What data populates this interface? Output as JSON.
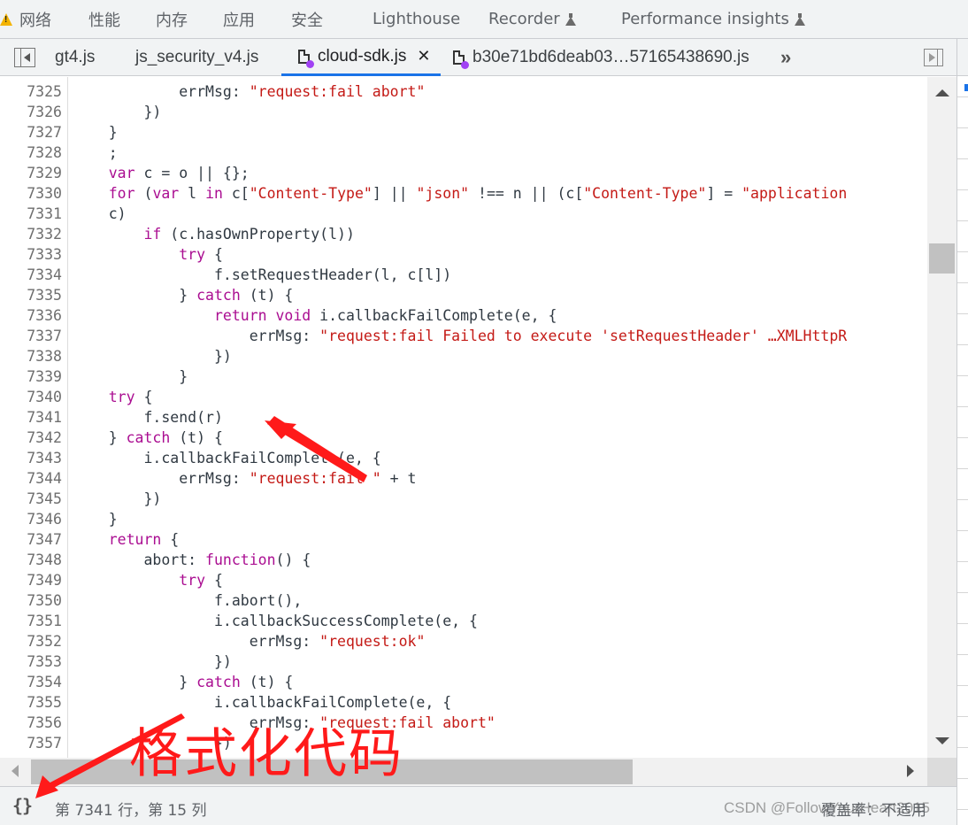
{
  "panel_tabs": [
    {
      "label": "网络",
      "warning": true
    },
    {
      "label": "性能"
    },
    {
      "label": "内存"
    },
    {
      "label": "应用"
    },
    {
      "label": "安全"
    },
    {
      "label": "Lighthouse"
    },
    {
      "label": "Recorder",
      "experimental": true
    },
    {
      "label": "Performance insights",
      "experimental": true
    }
  ],
  "file_tabs": [
    {
      "label": "gt4.js",
      "active": false
    },
    {
      "label": "js_security_v4.js",
      "active": false
    },
    {
      "label": "cloud-sdk.js",
      "active": true,
      "closable": true
    },
    {
      "label": "b30e71bd6deab03…57165438690.js",
      "active": false
    }
  ],
  "file_tabs_more": "»",
  "code_lines": [
    {
      "n": "7325",
      "indent": 12,
      "tokens": [
        [
          "p",
          "errMsg: "
        ],
        [
          "s",
          "\"request:fail abort\""
        ]
      ]
    },
    {
      "n": "7326",
      "indent": 8,
      "tokens": [
        [
          "p",
          "})"
        ]
      ]
    },
    {
      "n": "7327",
      "indent": 4,
      "tokens": [
        [
          "p",
          "}"
        ]
      ]
    },
    {
      "n": "7328",
      "indent": 4,
      "tokens": [
        [
          "p",
          ";"
        ]
      ]
    },
    {
      "n": "7329",
      "indent": 4,
      "tokens": [
        [
          "k",
          "var"
        ],
        [
          "p",
          " c = o || {};"
        ]
      ]
    },
    {
      "n": "7330",
      "indent": 4,
      "tokens": [
        [
          "k",
          "for"
        ],
        [
          "p",
          " ("
        ],
        [
          "k",
          "var"
        ],
        [
          "p",
          " l "
        ],
        [
          "k",
          "in"
        ],
        [
          "p",
          " c["
        ],
        [
          "s",
          "\"Content-Type\""
        ],
        [
          "p",
          "] || "
        ],
        [
          "s",
          "\"json\""
        ],
        [
          "p",
          " !== n || (c["
        ],
        [
          "s",
          "\"Content-Type\""
        ],
        [
          "p",
          "] = "
        ],
        [
          "s",
          "\"application"
        ]
      ]
    },
    {
      "n": "7331",
      "indent": 4,
      "tokens": [
        [
          "p",
          "c)"
        ]
      ]
    },
    {
      "n": "7332",
      "indent": 8,
      "tokens": [
        [
          "k",
          "if"
        ],
        [
          "p",
          " (c.hasOwnProperty(l))"
        ]
      ]
    },
    {
      "n": "7333",
      "indent": 12,
      "tokens": [
        [
          "k",
          "try"
        ],
        [
          "p",
          " {"
        ]
      ]
    },
    {
      "n": "7334",
      "indent": 16,
      "tokens": [
        [
          "p",
          "f.setRequestHeader(l, c[l])"
        ]
      ]
    },
    {
      "n": "7335",
      "indent": 12,
      "tokens": [
        [
          "p",
          "} "
        ],
        [
          "k",
          "catch"
        ],
        [
          "p",
          " (t) {"
        ]
      ]
    },
    {
      "n": "7336",
      "indent": 16,
      "tokens": [
        [
          "k",
          "return"
        ],
        [
          "p",
          " "
        ],
        [
          "k",
          "void"
        ],
        [
          "p",
          " i.callbackFailComplete(e, {"
        ]
      ]
    },
    {
      "n": "7337",
      "indent": 20,
      "tokens": [
        [
          "p",
          "errMsg: "
        ],
        [
          "s",
          "\"request:fail Failed to execute 'setRequestHeader' …XMLHttpR"
        ]
      ]
    },
    {
      "n": "7338",
      "indent": 16,
      "tokens": [
        [
          "p",
          "})"
        ]
      ]
    },
    {
      "n": "7339",
      "indent": 12,
      "tokens": [
        [
          "p",
          "}"
        ]
      ]
    },
    {
      "n": "7340",
      "indent": 4,
      "tokens": [
        [
          "k",
          "try"
        ],
        [
          "p",
          " {"
        ]
      ]
    },
    {
      "n": "7341",
      "indent": 8,
      "tokens": [
        [
          "p",
          "f.send(r)"
        ]
      ]
    },
    {
      "n": "7342",
      "indent": 4,
      "tokens": [
        [
          "p",
          "} "
        ],
        [
          "k",
          "catch"
        ],
        [
          "p",
          " (t) {"
        ]
      ]
    },
    {
      "n": "7343",
      "indent": 8,
      "tokens": [
        [
          "p",
          "i.callbackFailComplete(e, {"
        ]
      ]
    },
    {
      "n": "7344",
      "indent": 12,
      "tokens": [
        [
          "p",
          "errMsg: "
        ],
        [
          "s",
          "\"request:fail \""
        ],
        [
          "p",
          " + t"
        ]
      ]
    },
    {
      "n": "7345",
      "indent": 8,
      "tokens": [
        [
          "p",
          "})"
        ]
      ]
    },
    {
      "n": "7346",
      "indent": 4,
      "tokens": [
        [
          "p",
          "}"
        ]
      ]
    },
    {
      "n": "7347",
      "indent": 4,
      "tokens": [
        [
          "k",
          "return"
        ],
        [
          "p",
          " {"
        ]
      ]
    },
    {
      "n": "7348",
      "indent": 8,
      "tokens": [
        [
          "p",
          "abort: "
        ],
        [
          "k",
          "function"
        ],
        [
          "p",
          "() {"
        ]
      ]
    },
    {
      "n": "7349",
      "indent": 12,
      "tokens": [
        [
          "k",
          "try"
        ],
        [
          "p",
          " {"
        ]
      ]
    },
    {
      "n": "7350",
      "indent": 16,
      "tokens": [
        [
          "p",
          "f.abort(),"
        ]
      ]
    },
    {
      "n": "7351",
      "indent": 16,
      "tokens": [
        [
          "p",
          "i.callbackSuccessComplete(e, {"
        ]
      ]
    },
    {
      "n": "7352",
      "indent": 20,
      "tokens": [
        [
          "p",
          "errMsg: "
        ],
        [
          "s",
          "\"request:ok\""
        ]
      ]
    },
    {
      "n": "7353",
      "indent": 16,
      "tokens": [
        [
          "p",
          "})"
        ]
      ]
    },
    {
      "n": "7354",
      "indent": 12,
      "tokens": [
        [
          "p",
          "} "
        ],
        [
          "k",
          "catch"
        ],
        [
          "p",
          " (t) {"
        ]
      ]
    },
    {
      "n": "7355",
      "indent": 16,
      "tokens": [
        [
          "p",
          "i.callbackFailComplete(e, {"
        ]
      ]
    },
    {
      "n": "7356",
      "indent": 20,
      "tokens": [
        [
          "p",
          "errMsg: "
        ],
        [
          "s",
          "\"request:fail abort\""
        ]
      ]
    },
    {
      "n": "7357",
      "indent": 16,
      "tokens": [
        [
          "p",
          "})"
        ]
      ]
    }
  ],
  "status": {
    "format_button": "{}",
    "cursor_position": "第 7341 行，第 15 列",
    "coverage": "覆盖率：不适用"
  },
  "annotation": {
    "label": "格式化代码",
    "color": "#ff1a1a"
  },
  "watermark": "CSDN @FollowYourHeart2015",
  "colors": {
    "keyword": "#aa0d91",
    "string": "#c41a16",
    "plain": "#303942",
    "active_tab_underline": "#1a73e8",
    "file_modified_dot": "#a142f4"
  }
}
